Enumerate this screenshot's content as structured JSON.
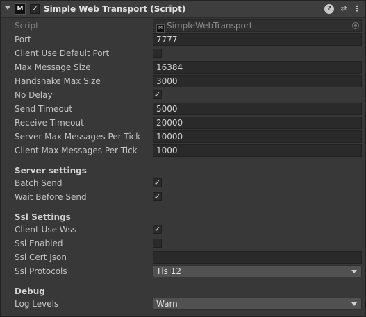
{
  "component": {
    "title": "Simple Web Transport (Script)",
    "enabled_check": "✓",
    "script_icon": "M",
    "icons": {
      "help": "?",
      "presets": "⇄",
      "menu": "⋮"
    }
  },
  "script": {
    "label": "Script",
    "value": "SimpleWebTransport"
  },
  "fields": {
    "port": {
      "label": "Port",
      "value": "7777"
    },
    "client_use_default_port": {
      "label": "Client Use Default Port",
      "checked": false
    },
    "max_message_size": {
      "label": "Max Message Size",
      "value": "16384"
    },
    "handshake_max_size": {
      "label": "Handshake Max Size",
      "value": "3000"
    },
    "no_delay": {
      "label": "No Delay",
      "checked": true,
      "mark": "✓"
    },
    "send_timeout": {
      "label": "Send Timeout",
      "value": "5000"
    },
    "receive_timeout": {
      "label": "Receive Timeout",
      "value": "20000"
    },
    "server_max_messages": {
      "label": "Server Max Messages Per Tick",
      "value": "10000"
    },
    "client_max_messages": {
      "label": "Client Max Messages Per Tick",
      "value": "1000"
    }
  },
  "server_settings": {
    "header": "Server settings",
    "batch_send": {
      "label": "Batch Send",
      "checked": true,
      "mark": "✓"
    },
    "wait_before_send": {
      "label": "Wait Before Send",
      "checked": true,
      "mark": "✓"
    }
  },
  "ssl_settings": {
    "header": "Ssl Settings",
    "client_use_wss": {
      "label": "Client Use Wss",
      "checked": true,
      "mark": "✓"
    },
    "ssl_enabled": {
      "label": "Ssl Enabled",
      "checked": false
    },
    "ssl_cert_json": {
      "label": "Ssl Cert Json",
      "value": ""
    },
    "ssl_protocols": {
      "label": "Ssl Protocols",
      "value": "Tls 12"
    }
  },
  "debug": {
    "header": "Debug",
    "log_levels": {
      "label": "Log Levels",
      "value": "Warn"
    }
  }
}
